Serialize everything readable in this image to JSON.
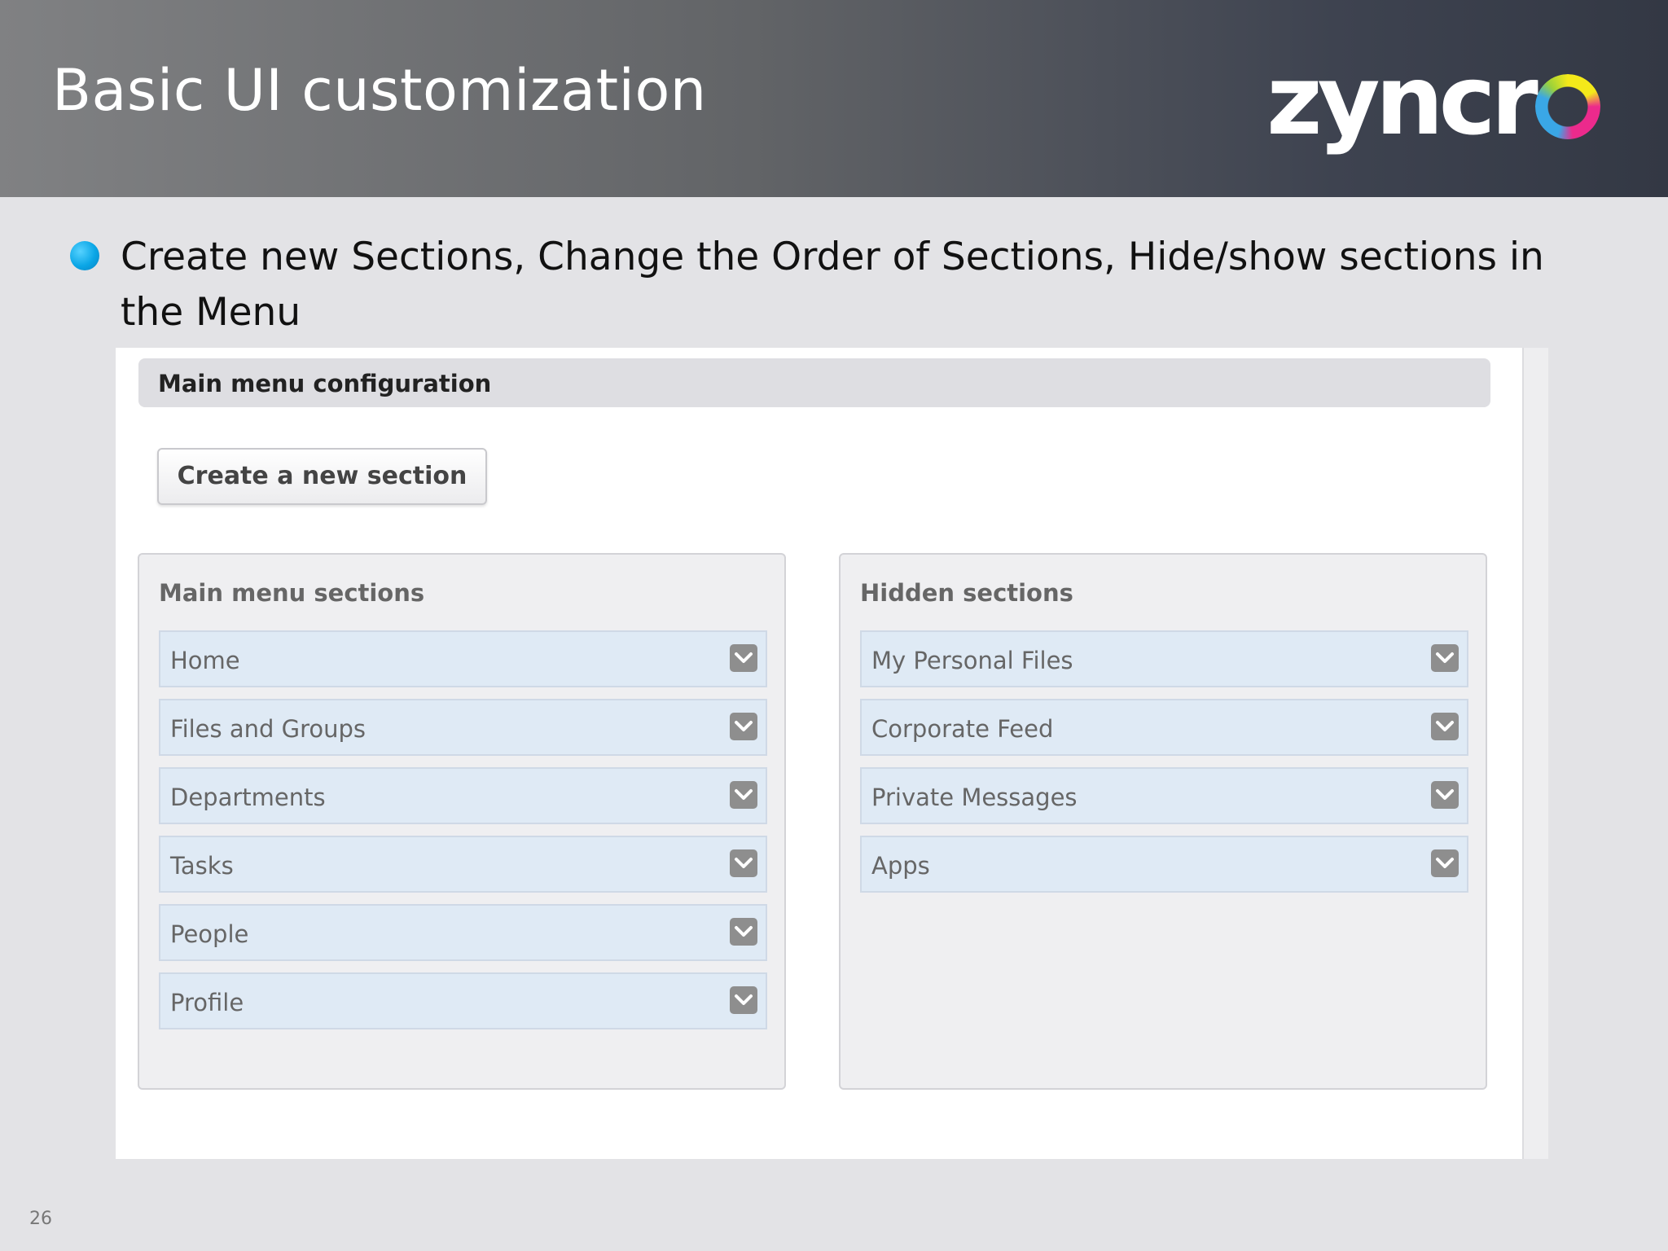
{
  "slide": {
    "title": "Basic UI customization",
    "logo_text": "zyncr",
    "bullet": "Create new Sections, Change the Order of Sections, Hide/show sections in the Menu",
    "page_number": "26"
  },
  "config": {
    "title": "Main menu configuration",
    "create_button_label": "Create a new section"
  },
  "main_sections": {
    "title": "Main menu sections",
    "items": [
      {
        "label": "Home"
      },
      {
        "label": "Files and Groups"
      },
      {
        "label": "Departments"
      },
      {
        "label": "Tasks"
      },
      {
        "label": "People"
      },
      {
        "label": "Profile"
      }
    ]
  },
  "hidden_sections": {
    "title": "Hidden sections",
    "items": [
      {
        "label": "My Personal Files"
      },
      {
        "label": "Corporate Feed"
      },
      {
        "label": "Private Messages"
      },
      {
        "label": "Apps"
      }
    ]
  },
  "icons": {
    "bullet": "bullet-dot-icon",
    "item_toggle": "chevron-down-icon",
    "logo_ring": "zyncro-ring-logo"
  },
  "colors": {
    "accent_bullet": "#0aa6e6",
    "item_background": "#dfeaf5",
    "header_dark": "#333844"
  }
}
